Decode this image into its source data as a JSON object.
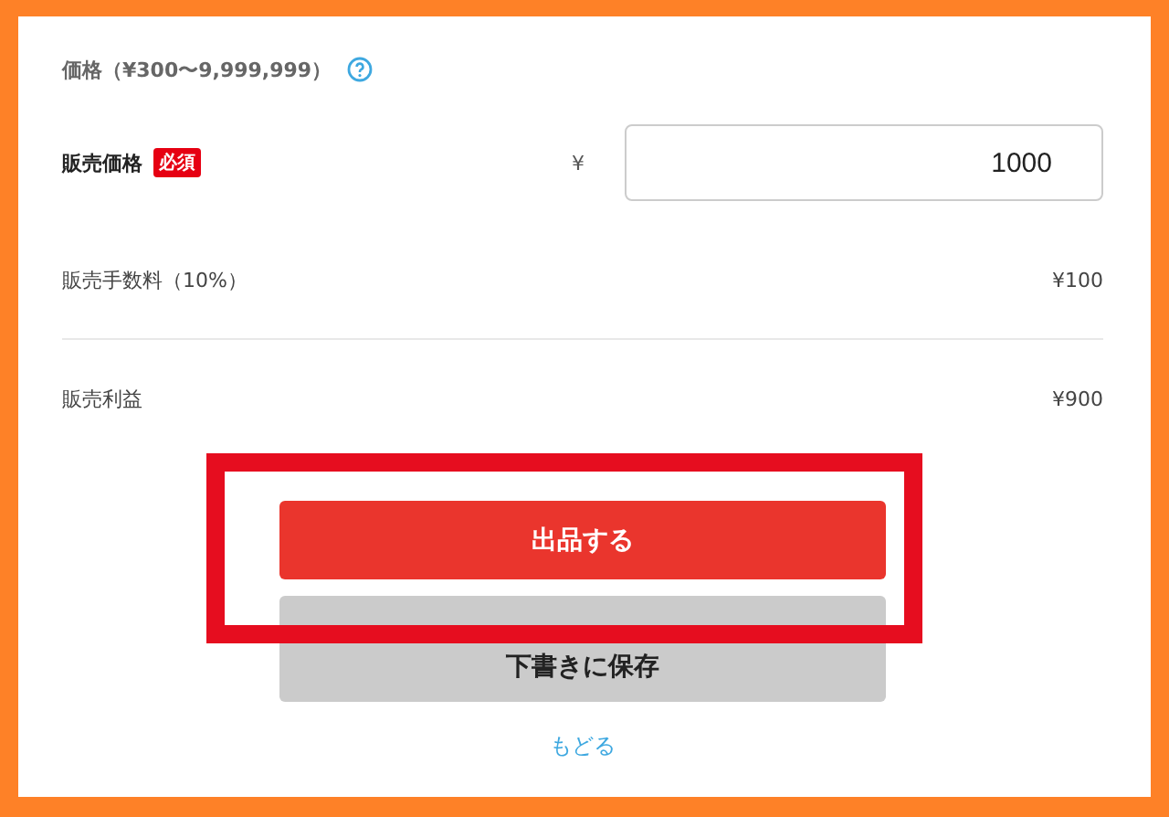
{
  "price_section": {
    "title": "価格（¥300〜9,999,999）"
  },
  "sale_price": {
    "label": "販売価格",
    "badge": "必須",
    "currency": "¥",
    "value": "1000"
  },
  "summary": [
    {
      "label": "販売手数料（10%）",
      "amount": "¥100"
    },
    {
      "label": "販売利益",
      "amount": "¥900"
    }
  ],
  "buttons": {
    "submit": "出品する",
    "draft": "下書きに保存",
    "back": "もどる"
  }
}
